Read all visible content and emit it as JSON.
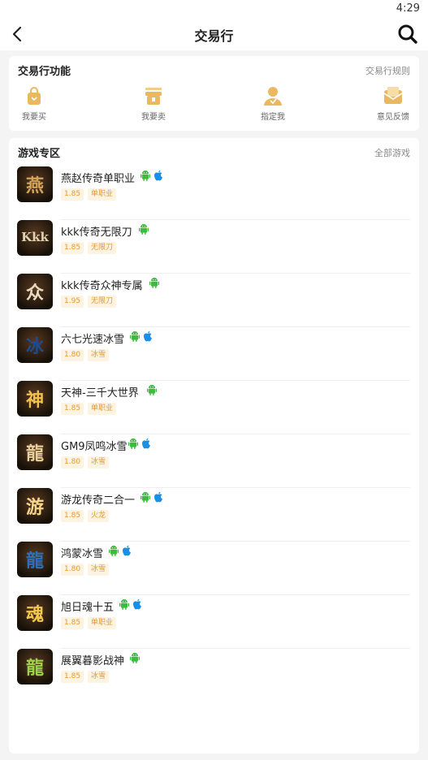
{
  "status": {
    "time": "4:29"
  },
  "nav": {
    "title": "交易行"
  },
  "functions": {
    "title": "交易行功能",
    "rules_link": "交易行规则",
    "items": [
      {
        "label": "我要买",
        "icon": "shopping-bag-icon"
      },
      {
        "label": "我要卖",
        "icon": "gift-box-icon"
      },
      {
        "label": "指定我",
        "icon": "person-icon"
      },
      {
        "label": "意见反馈",
        "icon": "mail-envelope-icon"
      }
    ]
  },
  "games": {
    "title": "游戏专区",
    "all_link": "全部游戏",
    "list": [
      {
        "name": "燕赵传奇单职业",
        "version": "1.85",
        "tag": "单职业",
        "android": true,
        "ios": true,
        "icon_text": "燕",
        "icon_color": "#d4a35a"
      },
      {
        "name": "kkk传奇无限刀",
        "version": "1.85",
        "tag": "无限刀",
        "android": true,
        "ios": false,
        "icon_text": "Kkk",
        "icon_color": "#e0d2b0"
      },
      {
        "name": "kkk传奇众神专属",
        "version": "1.95",
        "tag": "无限刀",
        "android": true,
        "ios": false,
        "icon_text": "众",
        "icon_color": "#e8dcc0"
      },
      {
        "name": "六七光速冰雪",
        "version": "1.80",
        "tag": "冰雪",
        "android": true,
        "ios": true,
        "icon_text": "冰",
        "icon_color": "#1d4b8c"
      },
      {
        "name": "天神-三千大世界",
        "version": "1.85",
        "tag": "单职业",
        "android": true,
        "ios": false,
        "icon_text": "神",
        "icon_color": "#f1c14a"
      },
      {
        "name": "GM9凤鸣冰雪",
        "version": "1.80",
        "tag": "冰雪",
        "android": true,
        "ios": true,
        "icon_text": "龍",
        "icon_color": "#e8cf9a"
      },
      {
        "name": "游龙传奇二合一",
        "version": "1.85",
        "tag": "火龙",
        "android": true,
        "ios": true,
        "icon_text": "游",
        "icon_color": "#f3d68a"
      },
      {
        "name": "鸿蒙冰雪",
        "version": "1.80",
        "tag": "冰雪",
        "android": true,
        "ios": true,
        "icon_text": "龍",
        "icon_color": "#2f6fb7"
      },
      {
        "name": "旭日魂十五",
        "version": "1.85",
        "tag": "单职业",
        "android": true,
        "ios": true,
        "icon_text": "魂",
        "icon_color": "#f2c84b"
      },
      {
        "name": "展翼暮影战神",
        "version": "1.85",
        "tag": "冰雪",
        "android": true,
        "ios": false,
        "icon_text": "龍",
        "icon_color": "#9fd24a"
      }
    ]
  },
  "colors": {
    "accent": "#e39b2c",
    "tag_bg": "#fdf3e3",
    "android": "#3dbb3d",
    "ios": "#1a8fe8",
    "icon_gold": "#e9b860"
  }
}
